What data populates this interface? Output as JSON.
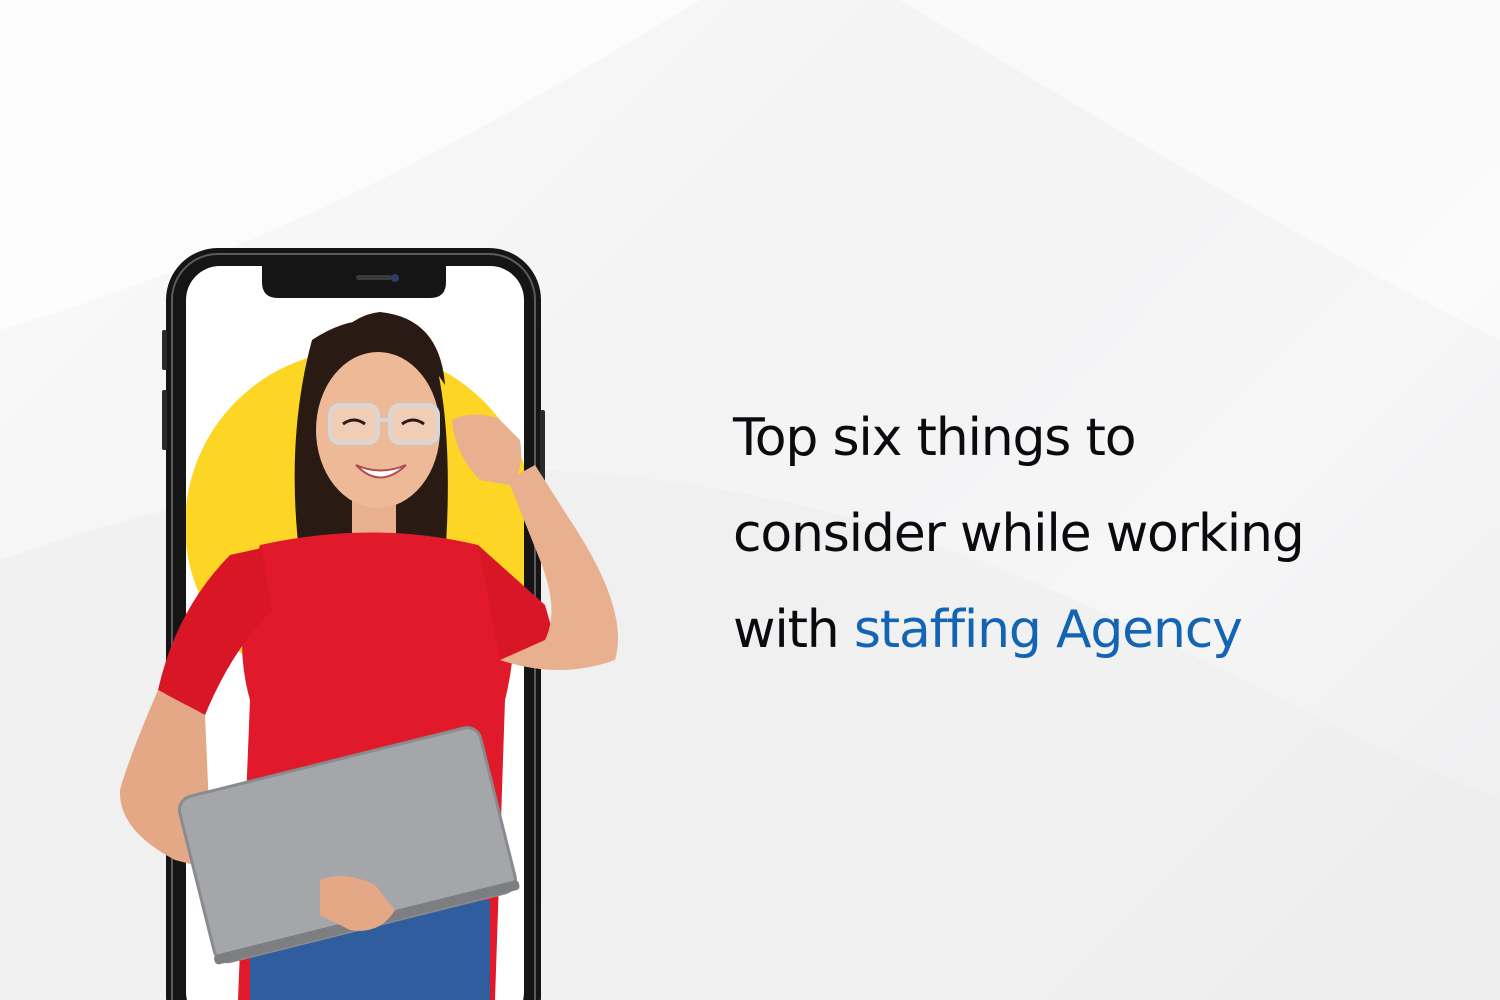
{
  "headline": {
    "line1": "Top six things to",
    "line2": "consider while working",
    "line3_prefix": "with",
    "line3_accent": "staffing Agency"
  },
  "colors": {
    "text": "#0b0b0f",
    "accent": "#1464b4",
    "yellow_circle": "#fdd524",
    "shirt": "#e01a2b",
    "laptop": "#a5a6a9",
    "phone_frame": "#151515",
    "jeans": "#2f5d9e"
  },
  "icons": [
    "smartphone-illustration",
    "person-illustration",
    "laptop-illustration"
  ]
}
